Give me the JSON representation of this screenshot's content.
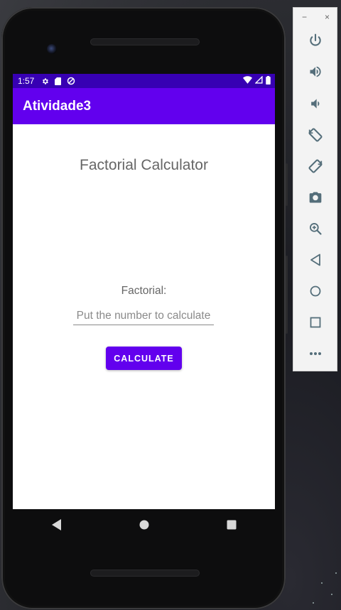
{
  "status_bar": {
    "time": "1:57",
    "icons": [
      "settings-icon",
      "sd-card-icon",
      "data-saver-icon",
      "wifi-icon",
      "signal-icon",
      "battery-icon"
    ]
  },
  "app_bar": {
    "title": "Atividade3"
  },
  "main": {
    "title": "Factorial Calculator",
    "factorial_label": "Factorial:",
    "number_input": {
      "value": "",
      "placeholder": "Put the number to calculate"
    },
    "calculate_button": "CALCULATE"
  },
  "nav_bar": {
    "buttons": [
      "back-icon",
      "home-icon",
      "recents-icon"
    ]
  },
  "emulator_panel": {
    "window_controls": {
      "minimize": "−",
      "close": "×"
    },
    "tools": [
      "power-icon",
      "volume-up-icon",
      "volume-down-icon",
      "rotate-left-icon",
      "rotate-right-icon",
      "screenshot-icon",
      "zoom-icon",
      "back-icon",
      "home-icon",
      "overview-icon",
      "more-icon"
    ]
  },
  "colors": {
    "status_bar": "#3700b3",
    "app_bar": "#6200ee",
    "accent_button": "#6200ee",
    "panel_icon": "#546e7a"
  }
}
